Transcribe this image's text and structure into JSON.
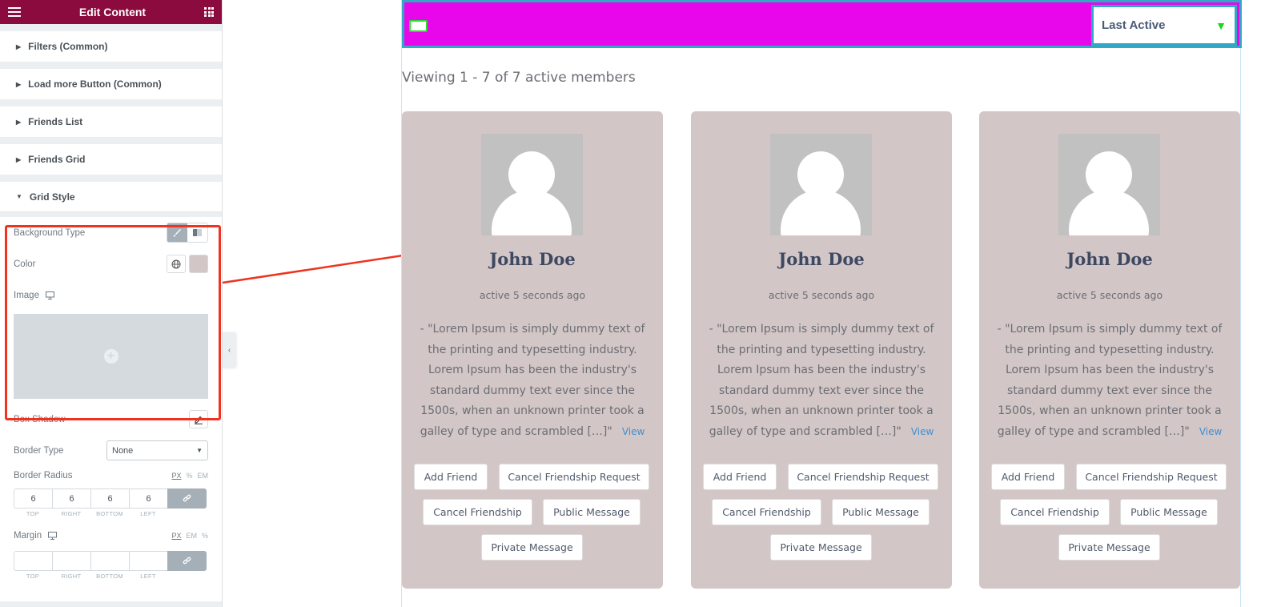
{
  "sidebar": {
    "title": "Edit Content",
    "sections": [
      {
        "label": "Filters (Common)"
      },
      {
        "label": "Load more Button (Common)"
      },
      {
        "label": "Friends List"
      },
      {
        "label": "Friends Grid"
      },
      {
        "label": "Grid Style"
      }
    ],
    "controls": {
      "background_type_label": "Background Type",
      "color_label": "Color",
      "color_value": "#d3c6c6",
      "image_label": "Image",
      "box_shadow_label": "Box Shadow",
      "border_type_label": "Border Type",
      "border_type_value": "None",
      "border_radius_label": "Border Radius",
      "border_radius_units": [
        "PX",
        "%",
        "EM"
      ],
      "border_radius_values": [
        "6",
        "6",
        "6",
        "6"
      ],
      "dim_labels": [
        "TOP",
        "RIGHT",
        "BOTTOM",
        "LEFT"
      ],
      "margin_label": "Margin",
      "margin_units": [
        "PX",
        "EM",
        "%"
      ],
      "margin_values": [
        "",
        "",
        "",
        ""
      ]
    }
  },
  "main": {
    "order_select": "Last Active",
    "viewing_text": "Viewing 1 - 7 of 7 active members",
    "members": [
      {
        "name": "John Doe",
        "last_active": "active 5 seconds ago",
        "bio": "- \"Lorem Ipsum is simply dummy text of the printing and typesetting industry. Lorem Ipsum has been the industry's standard dummy text ever since the 1500s, when an unknown printer took a galley of type and scrambled […]\"",
        "view_label": "View"
      },
      {
        "name": "John Doe",
        "last_active": "active 5 seconds ago",
        "bio": "- \"Lorem Ipsum is simply dummy text of the printing and typesetting industry. Lorem Ipsum has been the industry's standard dummy text ever since the 1500s, when an unknown printer took a galley of type and scrambled […]\"",
        "view_label": "View"
      },
      {
        "name": "John Doe",
        "last_active": "active 5 seconds ago",
        "bio": "- \"Lorem Ipsum is simply dummy text of the printing and typesetting industry. Lorem Ipsum has been the industry's standard dummy text ever since the 1500s, when an unknown printer took a galley of type and scrambled […]\"",
        "view_label": "View"
      }
    ],
    "buttons": {
      "add_friend": "Add Friend",
      "cancel_request": "Cancel Friendship Request",
      "cancel_friendship": "Cancel Friendship",
      "public_message": "Public Message",
      "private_message": "Private Message"
    }
  },
  "colors": {
    "header": "#8c0b3e",
    "topbar": "#e806ea",
    "card": "#d3c6c6",
    "highlight": "#f0321e"
  }
}
